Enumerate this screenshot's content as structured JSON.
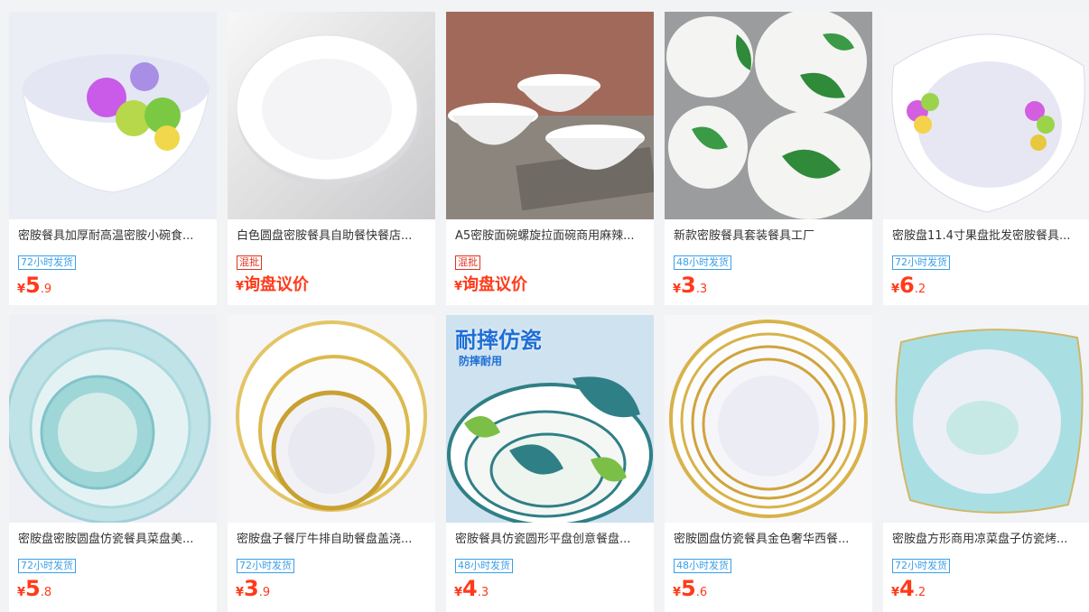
{
  "products": [
    {
      "title": "密胺餐具加厚耐高温密胺小碗食...",
      "tag": "72小时发货",
      "tag_style": "blue",
      "currency": "¥",
      "price_int": "5",
      "price_dec": ".9",
      "image_icon": "bowl-flower-icon"
    },
    {
      "title": "白色圆盘密胺餐具自助餐快餐店...",
      "tag": "混批",
      "tag_style": "red",
      "currency": "¥",
      "price_text": "询盘议价",
      "image_icon": "white-plate-icon"
    },
    {
      "title": "A5密胺面碗螺旋拉面碗商用麻辣...",
      "tag": "混批",
      "tag_style": "red",
      "currency": "¥",
      "price_text": "询盘议价",
      "image_icon": "stacked-bowls-icon"
    },
    {
      "title": "新款密胺餐具套装餐具工厂",
      "tag": "48小时发货",
      "tag_style": "blue",
      "currency": "¥",
      "price_int": "3",
      "price_dec": ".3",
      "image_icon": "leaf-bowls-icon"
    },
    {
      "title": "密胺盘11.4寸果盘批发密胺餐具...",
      "tag": "72小时发货",
      "tag_style": "blue",
      "currency": "¥",
      "price_int": "6",
      "price_dec": ".2",
      "image_icon": "flower-plate-icon"
    },
    {
      "title": "密胺盘密胺圆盘仿瓷餐具菜盘美...",
      "tag": "72小时发货",
      "tag_style": "blue",
      "currency": "¥",
      "price_int": "5",
      "price_dec": ".8",
      "image_icon": "teal-plates-icon"
    },
    {
      "title": "密胺盘子餐厅牛排自助餐盘盖浇...",
      "tag": "72小时发货",
      "tag_style": "blue",
      "currency": "¥",
      "price_int": "3",
      "price_dec": ".9",
      "image_icon": "gold-rim-plates-icon"
    },
    {
      "title": "密胺餐具仿瓷圆形平盘创意餐盘...",
      "tag": "48小时发货",
      "tag_style": "blue",
      "currency": "¥",
      "price_int": "4",
      "price_dec": ".3",
      "image_icon": "tropical-plates-icon",
      "slogan": "耐摔仿瓷",
      "slogan_sub": "防摔耐用"
    },
    {
      "title": "密胺圆盘仿瓷餐具金色奢华西餐...",
      "tag": "48小时发货",
      "tag_style": "blue",
      "currency": "¥",
      "price_int": "5",
      "price_dec": ".6",
      "image_icon": "gold-nested-plates-icon"
    },
    {
      "title": "密胺盘方形商用凉菜盘子仿瓷烤...",
      "tag": "72小时发货",
      "tag_style": "blue",
      "currency": "¥",
      "price_int": "4",
      "price_dec": ".2",
      "image_icon": "square-plate-icon"
    }
  ],
  "colors": {
    "price": "#ff3a1a",
    "tag_blue": "#3a9fe8",
    "tag_red": "#e0331e"
  }
}
